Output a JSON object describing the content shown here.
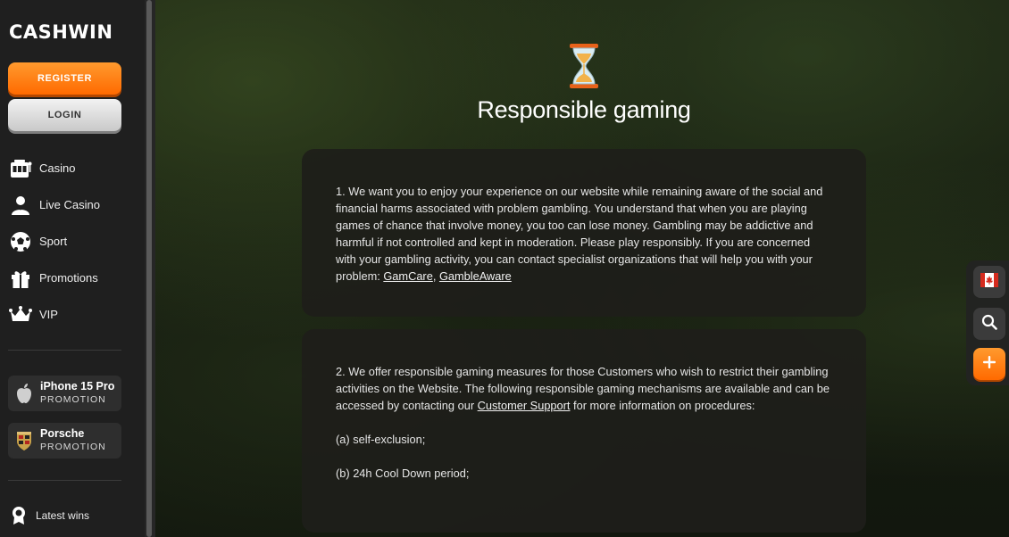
{
  "sidebar": {
    "logo": "CASHWIN",
    "register_label": "REGISTER",
    "login_label": "LOGIN",
    "nav": [
      {
        "label": "Casino",
        "icon": "slot-machine-icon"
      },
      {
        "label": "Live Casino",
        "icon": "dealer-icon"
      },
      {
        "label": "Sport",
        "icon": "soccer-ball-icon"
      },
      {
        "label": "Promotions",
        "icon": "gift-icon"
      },
      {
        "label": "VIP",
        "icon": "crown-icon"
      }
    ],
    "promos": [
      {
        "name": "iPhone 15 Pro",
        "tag": "PROMOTION",
        "icon": "apple-icon"
      },
      {
        "name": "Porsche",
        "tag": "PROMOTION",
        "icon": "porsche-crest-icon"
      }
    ],
    "latest_wins": "Latest wins"
  },
  "main": {
    "title": "Responsible gaming",
    "section1": {
      "text": "1. We want you to enjoy your experience on our website while remaining aware of the social and financial harms associated with problem gambling. You understand that when you are playing games of chance that involve money, you too can lose money. Gambling may be addictive and harmful if not controlled and kept in moderation. Please play responsibly. If you are concerned with your gambling activity, you can contact specialist organizations that will help you with your problem: ",
      "link1": "GamCare",
      "sep": ", ",
      "link2": "GambleAware"
    },
    "section2": {
      "text": "2. We offer responsible gaming measures for those Customers who wish to restrict their gambling activities on the Website. The following responsible gaming mechanisms are available and can be accessed by contacting our ",
      "link": "Customer Support",
      "text_after": " for more information on procedures:",
      "item_a": "(a) self-exclusion;",
      "item_b": "(b) 24h Cool Down period;"
    }
  },
  "widget": {
    "flag_icon": "canada-flag-icon",
    "search_icon": "search-icon",
    "plus_icon": "plus-icon"
  },
  "colors": {
    "accent": "#ff7a10",
    "sidebar_bg": "#1f1f1f",
    "card_bg": "#1e1e1a"
  }
}
